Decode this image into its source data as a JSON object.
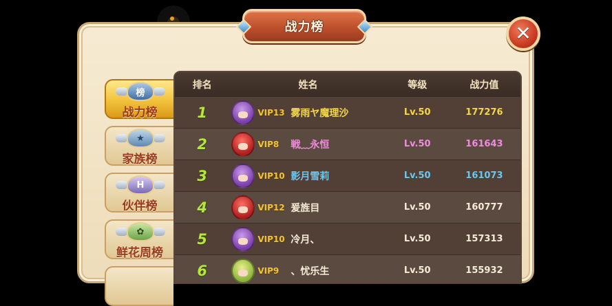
{
  "window": {
    "title": "战力榜",
    "close_symbol": "✕"
  },
  "tabs": [
    {
      "label": "战力榜",
      "badge": "榜",
      "active": true
    },
    {
      "label": "家族榜",
      "badge": "★",
      "active": false
    },
    {
      "label": "伙伴榜",
      "badge": "H",
      "active": false
    },
    {
      "label": "鲜花周榜",
      "badge": "✿",
      "active": false
    }
  ],
  "table": {
    "headers": {
      "rank": "排名",
      "name": "姓名",
      "level": "等级",
      "power": "战力值"
    },
    "rows": [
      {
        "rank": "1",
        "vip": "VIP13",
        "name": "雾雨ヤ魔理沙",
        "level": "Lv.50",
        "power": "177276",
        "color": "yellow",
        "avatar": "purple"
      },
      {
        "rank": "2",
        "vip": "VIP8",
        "name": "戦﹏永恒",
        "level": "Lv.50",
        "power": "161643",
        "color": "pink",
        "avatar": "red"
      },
      {
        "rank": "3",
        "vip": "VIP10",
        "name": "影月雪莉",
        "level": "Lv.50",
        "power": "161073",
        "color": "blue",
        "avatar": "purple"
      },
      {
        "rank": "4",
        "vip": "VIP12",
        "name": "爰旌目",
        "level": "Lv.50",
        "power": "160777",
        "color": "white",
        "avatar": "red"
      },
      {
        "rank": "5",
        "vip": "VIP10",
        "name": "冷月、",
        "level": "Lv.50",
        "power": "157313",
        "color": "white",
        "avatar": "purple"
      },
      {
        "rank": "6",
        "vip": "VIP9",
        "name": "、忧乐生",
        "level": "Lv.50",
        "power": "155932",
        "color": "white",
        "avatar": "green"
      }
    ]
  }
}
